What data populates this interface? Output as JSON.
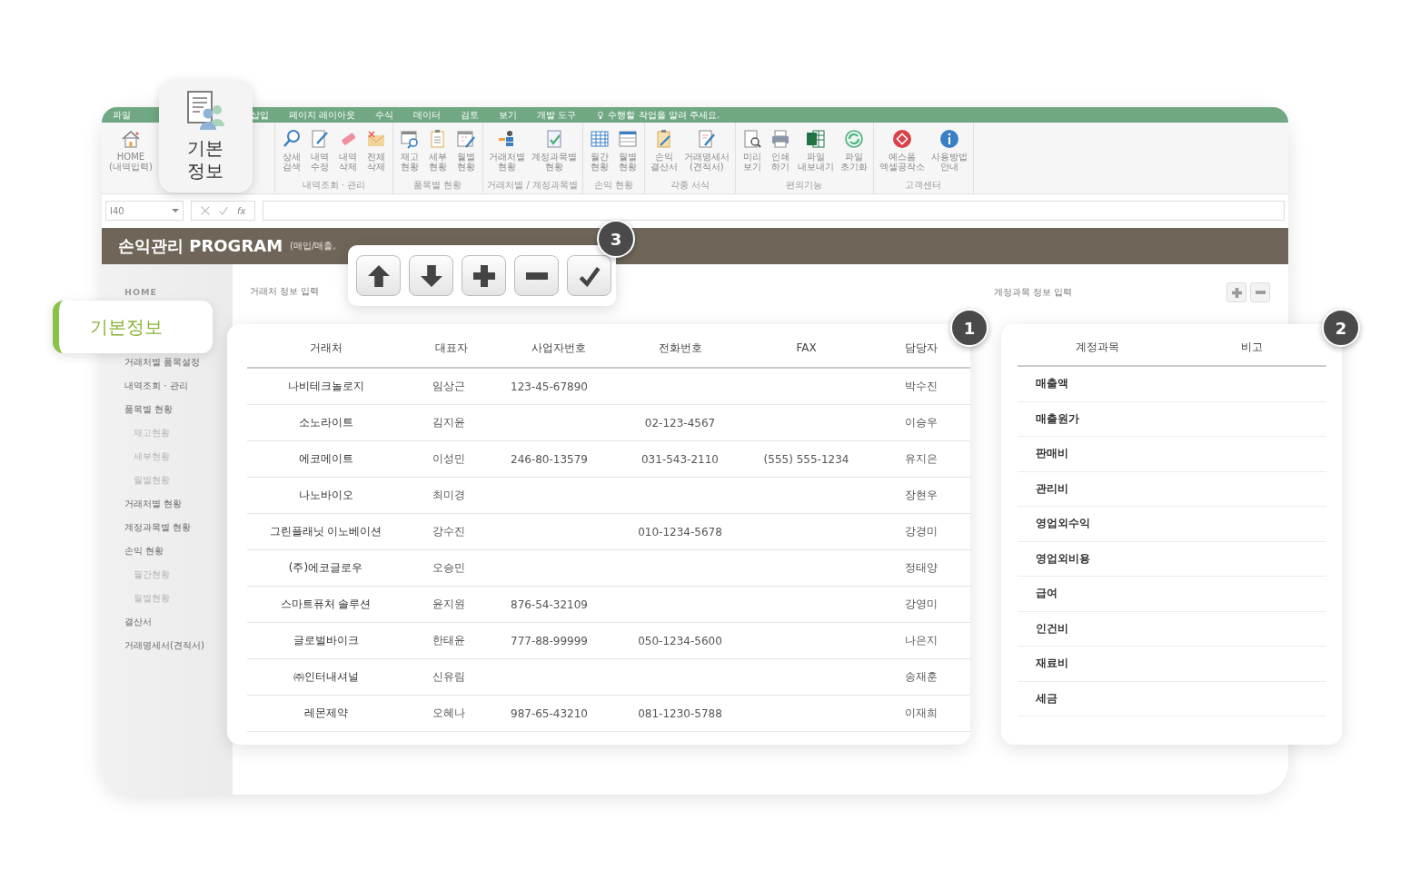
{
  "ribbon": {
    "tabs": [
      {
        "label": "파일"
      },
      {
        "label": "삽입"
      },
      {
        "label": "페이지 레이아웃"
      },
      {
        "label": "수식"
      },
      {
        "label": "데이터"
      },
      {
        "label": "검토"
      },
      {
        "label": "보기"
      },
      {
        "label": "개발 도구"
      }
    ],
    "tell_me": "수행할 작업을 알려 주세요.",
    "groups": [
      {
        "buttons": [
          {
            "label": "HOME (내역입력)",
            "featured": false
          },
          {
            "label": "기본 정보",
            "featured": true
          }
        ]
      },
      {
        "label": "내역조회 · 관리",
        "buttons": [
          {
            "label": "상세 검색",
            "featured": false
          },
          {
            "label": "내역 수정",
            "featured": false
          },
          {
            "label": "내역 삭제",
            "featured": false
          },
          {
            "label": "전체 삭제",
            "featured": false
          }
        ]
      },
      {
        "label": "품목별 현황",
        "buttons": [
          {
            "label": "재고 현황",
            "featured": false
          },
          {
            "label": "세부 현황",
            "featured": false
          },
          {
            "label": "월별 현황",
            "featured": false
          }
        ]
      },
      {
        "label": "거래처별 / 계정과목별",
        "buttons": [
          {
            "label": "거래처별 현황",
            "featured": false
          },
          {
            "label": "계정과목별 현황",
            "featured": false
          }
        ]
      },
      {
        "label": "손익 현황",
        "buttons": [
          {
            "label": "월간 현황",
            "featured": false
          },
          {
            "label": "월별 현황",
            "featured": false
          }
        ]
      },
      {
        "label": "각종 서식",
        "buttons": [
          {
            "label": "손익 결산서",
            "featured": false
          },
          {
            "label": "거래명세서 (견적서)",
            "featured": false
          }
        ]
      },
      {
        "label": "편의기능",
        "buttons": [
          {
            "label": "미리 보기",
            "featured": false
          },
          {
            "label": "인쇄 하기",
            "featured": false
          },
          {
            "label": "파일 내보내기",
            "featured": false
          },
          {
            "label": "파일 초기화",
            "featured": false
          }
        ]
      },
      {
        "label": "고객센터",
        "buttons": [
          {
            "label": "예스폼 엑셀공작소",
            "featured": false
          },
          {
            "label": "사용방법 안내",
            "featured": false
          }
        ]
      }
    ]
  },
  "formula_bar": {
    "name_box": "I40",
    "function_label": "fx"
  },
  "title_bar": {
    "title": "손익관리 PROGRAM",
    "subtitle": "(매입/매출,"
  },
  "sidebar": {
    "items": [
      {
        "label": "HOME",
        "kind": "heading",
        "selected": false
      },
      {
        "label": "기본정보",
        "kind": "link",
        "selected": true
      },
      {
        "label": "거래처별 품목설정",
        "kind": "link",
        "selected": false
      },
      {
        "label": "내역조회 · 관리",
        "kind": "link",
        "selected": false
      },
      {
        "label": "품목별 현황",
        "kind": "link",
        "selected": false,
        "children": [
          {
            "label": "재고현황",
            "kind": "link",
            "selected": false
          },
          {
            "label": "세부현황",
            "kind": "link",
            "selected": false
          },
          {
            "label": "월별현황",
            "kind": "link",
            "selected": false
          }
        ]
      },
      {
        "label": "거래처별 현황",
        "kind": "link",
        "selected": false
      },
      {
        "label": "계정과목별 현황",
        "kind": "link",
        "selected": false
      },
      {
        "label": "손익 현황",
        "kind": "link",
        "selected": false,
        "children": [
          {
            "label": "월간현황",
            "kind": "link",
            "selected": false
          },
          {
            "label": "월별현황",
            "kind": "link",
            "selected": false
          }
        ]
      },
      {
        "label": "결산서",
        "kind": "link",
        "selected": false
      },
      {
        "label": "거래명세서(견적서)",
        "kind": "link",
        "selected": false
      }
    ]
  },
  "toolbar": {
    "badge": "3",
    "buttons": [
      {
        "kind": "up"
      },
      {
        "kind": "down"
      },
      {
        "kind": "add"
      },
      {
        "kind": "remove"
      },
      {
        "kind": "confirm"
      }
    ]
  },
  "customer_panel": {
    "label": "거래처 정보 입력",
    "badge": "1",
    "columns": [
      "거래처",
      "대표자",
      "사업자번호",
      "전화번호",
      "FAX",
      "담당자"
    ],
    "rows": [
      {
        "company": "나비테크놀로지",
        "representative": "임상근",
        "business_no": "123-45-67890",
        "contact": "박수진"
      },
      {
        "company": "소노라이트",
        "representative": "김지윤",
        "phone": "02-123-4567",
        "contact": "이승우"
      },
      {
        "company": "에코메이트",
        "representative": "이성민",
        "business_no": "246-80-13579",
        "phone": "031-543-2110",
        "fax": "(555) 555-1234",
        "contact": "유지은"
      },
      {
        "company": "나노바이오",
        "representative": "최미경",
        "contact": "장현우"
      },
      {
        "company": "그린플래닛 이노베이션",
        "representative": "강수진",
        "phone": "010-1234-5678",
        "contact": "강경미"
      },
      {
        "company": "(주)에코글로우",
        "representative": "오승민",
        "contact": "정태양"
      },
      {
        "company": "스마트퓨처 솔루션",
        "representative": "윤지원",
        "business_no": "876-54-32109",
        "contact": "강영미"
      },
      {
        "company": "글로벌바이크",
        "representative": "한태윤",
        "business_no": "777-88-99999",
        "phone": "050-1234-5600",
        "contact": "나은지"
      },
      {
        "company": "㈜인터내셔널",
        "representative": "신유림",
        "contact": "송재훈"
      },
      {
        "company": "레몬제약",
        "representative": "오혜나",
        "business_no": "987-65-43210",
        "phone": "081-1230-5788",
        "contact": "이재희"
      }
    ]
  },
  "account_panel": {
    "label": "계정과목 정보 입력",
    "badge": "2",
    "buttons": [
      {
        "kind": "add"
      },
      {
        "kind": "remove"
      }
    ],
    "columns": [
      "계정과목",
      "비고"
    ],
    "rows": [
      {
        "account": "매출액"
      },
      {
        "account": "매출원가"
      },
      {
        "account": "판매비"
      },
      {
        "account": "관리비"
      },
      {
        "account": "영업외수익"
      },
      {
        "account": "영업외비용"
      },
      {
        "account": "급여"
      },
      {
        "account": "인건비"
      },
      {
        "account": "재료비"
      },
      {
        "account": "세금"
      }
    ]
  }
}
